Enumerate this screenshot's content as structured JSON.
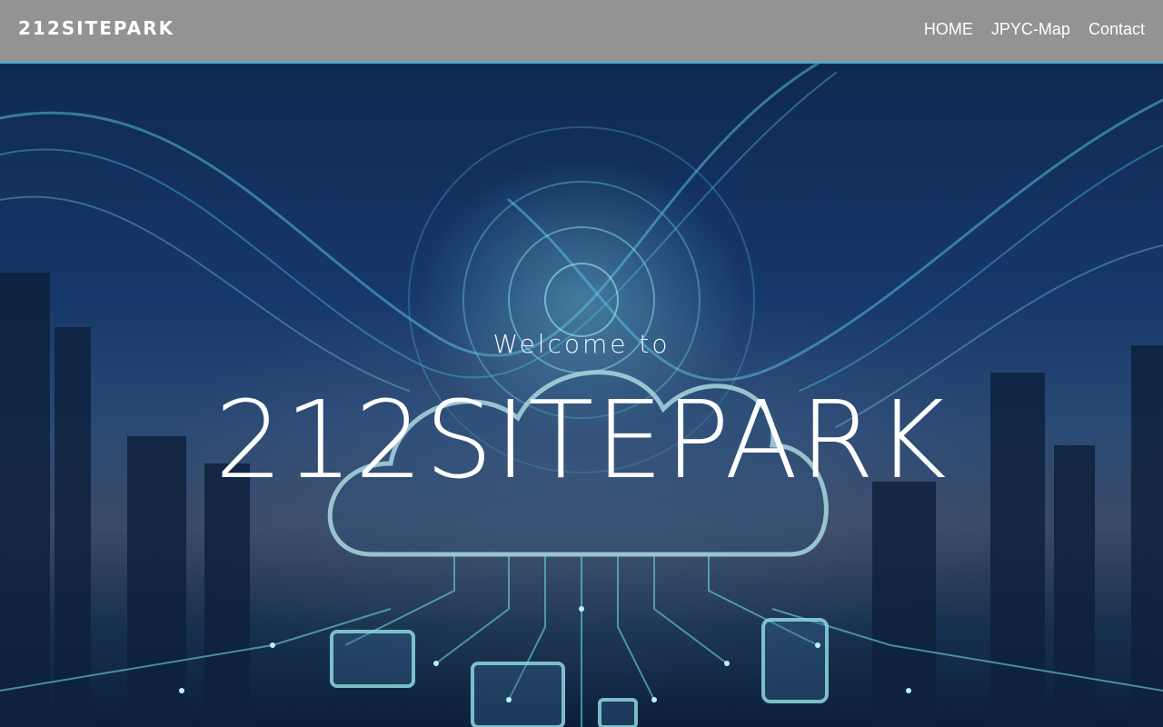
{
  "header": {
    "logo": "212SITEPARK",
    "nav": [
      {
        "label": "HOME"
      },
      {
        "label": "JPYC-Map"
      },
      {
        "label": "Contact"
      }
    ]
  },
  "hero": {
    "welcome_text": "Welcome to",
    "title": "212SITEPARK"
  },
  "colors": {
    "header_bg": "#939393",
    "hero_accent": "#6fd3e3",
    "text": "#ffffff"
  }
}
